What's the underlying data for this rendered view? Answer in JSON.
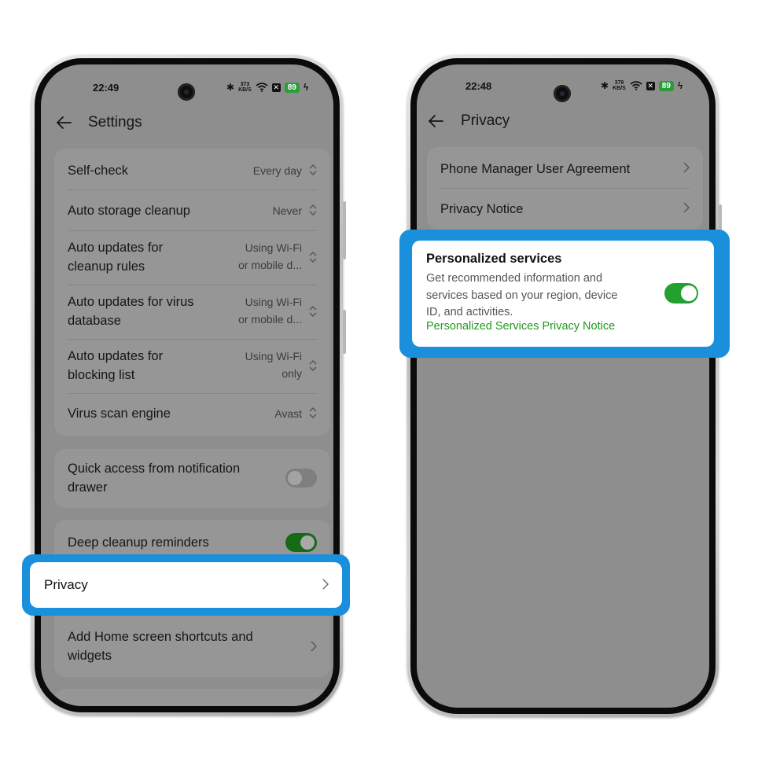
{
  "left_phone": {
    "status": {
      "time": "22:49",
      "speed_top": "373",
      "speed_bottom": "KB/S",
      "battery": "89"
    },
    "header": {
      "title": "Settings"
    },
    "rows": [
      {
        "label": "Self-check",
        "value": "Every day"
      },
      {
        "label": "Auto storage cleanup",
        "value": "Never"
      },
      {
        "label_line1": "Auto updates for",
        "label_line2": "cleanup rules",
        "value_line1": "Using Wi-Fi",
        "value_line2": "or mobile d..."
      },
      {
        "label_line1": "Auto updates for virus",
        "label_line2": "database",
        "value_line1": "Using Wi-Fi",
        "value_line2": "or mobile d..."
      },
      {
        "label_line1": "Auto updates for",
        "label_line2": "blocking list",
        "value_line1": "Using Wi-Fi",
        "value_line2": "only"
      },
      {
        "label": "Virus scan engine",
        "value": "Avast"
      }
    ],
    "quick_access": {
      "label_line1": "Quick access from notification",
      "label_line2": "drawer",
      "enabled": false
    },
    "deep_cleanup": {
      "label": "Deep cleanup reminders",
      "enabled": true
    },
    "privacy": {
      "label": "Privacy"
    },
    "shortcuts": {
      "label_line1": "Add Home screen shortcuts and",
      "label_line2": "widgets"
    }
  },
  "right_phone": {
    "status": {
      "time": "22:48",
      "speed_top": "379",
      "speed_bottom": "KB/S",
      "battery": "89"
    },
    "header": {
      "title": "Privacy"
    },
    "rows": [
      {
        "label": "Phone Manager User Agreement"
      },
      {
        "label": "Privacy Notice"
      }
    ],
    "personalized": {
      "title": "Personalized services",
      "desc_line1": "Get recommended information and",
      "desc_line2": "services based on your region, device",
      "desc_line3": "ID, and activities.",
      "link": "Personalized Services Privacy Notice",
      "enabled": true
    }
  },
  "colors": {
    "highlight": "#1a8fdc",
    "toggle_on": "#23a12f",
    "link": "#1f9a1f",
    "dim_overlay": "#8e8e8e"
  }
}
